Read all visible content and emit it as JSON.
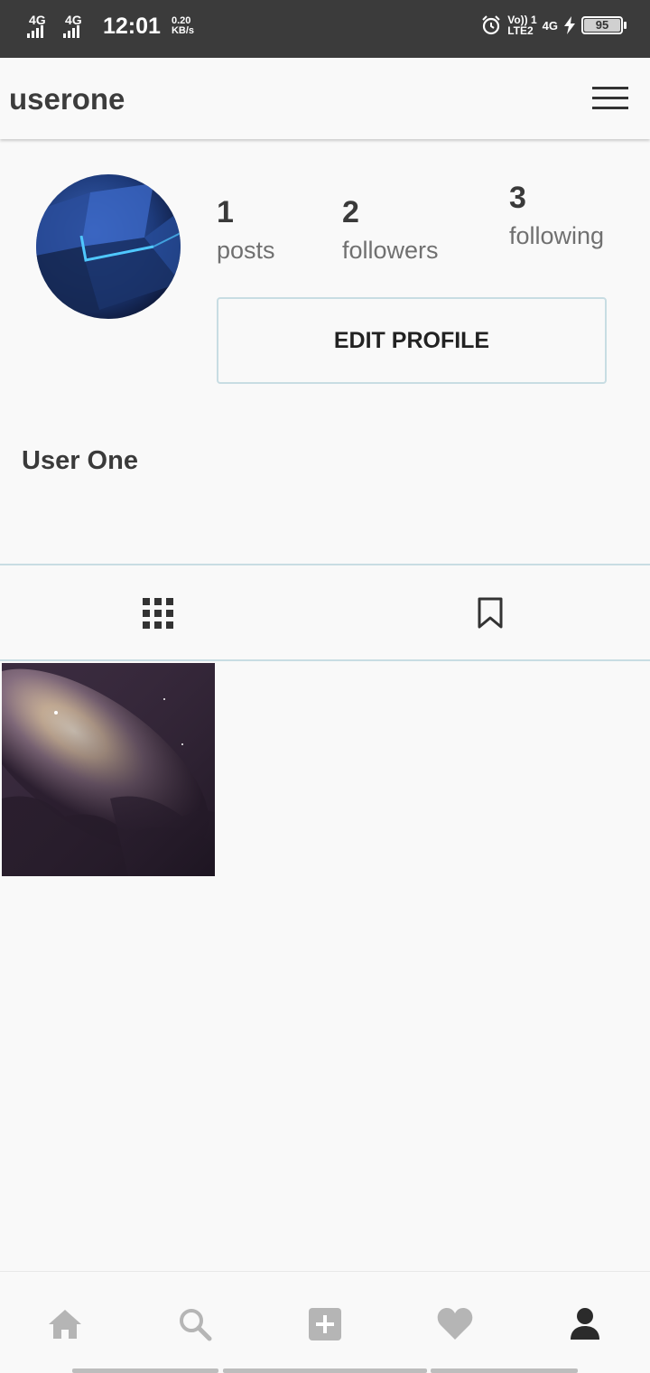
{
  "status_bar": {
    "sim1_network": "4G",
    "sim2_network": "4G",
    "time": "12:01",
    "speed_value": "0.20",
    "speed_unit": "KB/s",
    "volte_top": "Vo)) 1",
    "volte_bottom": "LTE2",
    "network_right": "4G",
    "battery_level": "95"
  },
  "header": {
    "username": "userone",
    "menu_icon": "hamburger-menu-icon"
  },
  "profile": {
    "stats": {
      "posts_count": "1",
      "posts_label": "posts",
      "followers_count": "2",
      "followers_label": "followers",
      "following_count": "3",
      "following_label": "following"
    },
    "edit_button_label": "EDIT PROFILE",
    "display_name": "User One"
  },
  "tabs": {
    "grid_icon": "grid-icon",
    "saved_icon": "bookmark-icon"
  },
  "bottom_nav": {
    "items": [
      "home-icon",
      "search-icon",
      "add-post-icon",
      "heart-icon",
      "profile-icon"
    ],
    "active": "profile-icon",
    "active_color": "#2b2b2b",
    "inactive_color": "#b5b5b5"
  },
  "colors": {
    "status_bar_bg": "#3b3b3b",
    "background": "#f9f9f9",
    "divider": "#c8dde3"
  }
}
